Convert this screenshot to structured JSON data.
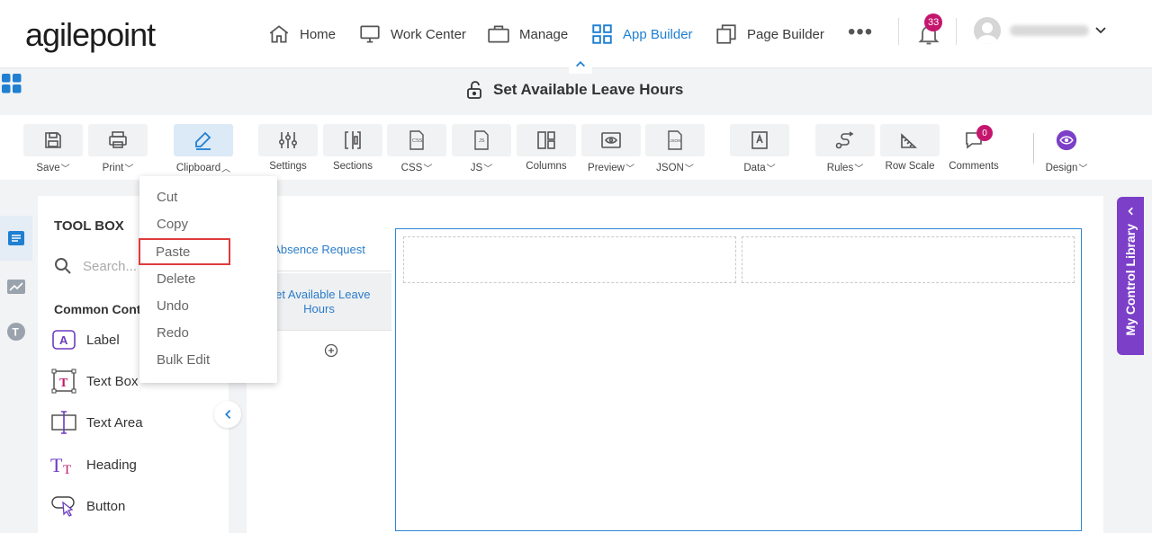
{
  "brand": {
    "logo_text": "agilepoint"
  },
  "nav": {
    "items": [
      {
        "label": "Home",
        "icon": "home-icon",
        "active": false
      },
      {
        "label": "Work Center",
        "icon": "monitor-icon",
        "active": false
      },
      {
        "label": "Manage",
        "icon": "briefcase-icon",
        "active": false
      },
      {
        "label": "App Builder",
        "icon": "grid-icon",
        "active": true
      },
      {
        "label": "Page Builder",
        "icon": "copy-icon",
        "active": false
      }
    ],
    "more": "•••",
    "notifications_count": "33"
  },
  "form": {
    "title": "Set Available Leave Hours"
  },
  "toolbar": {
    "save": "Save",
    "print": "Print",
    "clipboard": "Clipboard",
    "settings": "Settings",
    "sections": "Sections",
    "css": "CSS",
    "js": "JS",
    "columns": "Columns",
    "preview": "Preview",
    "json": "JSON",
    "data": "Data",
    "rules": "Rules",
    "row_scale": "Row Scale",
    "comments": "Comments",
    "comments_count": "0",
    "design": "Design"
  },
  "clipboard_menu": {
    "items": [
      "Cut",
      "Copy",
      "Paste",
      "Delete",
      "Undo",
      "Redo",
      "Bulk Edit"
    ],
    "highlighted": "Paste"
  },
  "toolbox": {
    "title": "TOOL BOX",
    "search_placeholder": "Search...",
    "section": "Common Controls",
    "items": [
      {
        "label": "Label",
        "icon": "label-icon"
      },
      {
        "label": "Text Box",
        "icon": "textbox-icon"
      },
      {
        "label": "Text Area",
        "icon": "textarea-icon"
      },
      {
        "label": "Heading",
        "icon": "heading-icon"
      },
      {
        "label": "Button",
        "icon": "button-icon"
      }
    ]
  },
  "pages": {
    "tabs": [
      "Absence Request",
      "Set Available Leave Hours"
    ]
  },
  "right_panel": {
    "label": "My Control Library"
  },
  "colors": {
    "accent": "#1f7fd1",
    "badge": "#c4166d",
    "library": "#7b3fc8",
    "highlight": "#e03b3b"
  }
}
